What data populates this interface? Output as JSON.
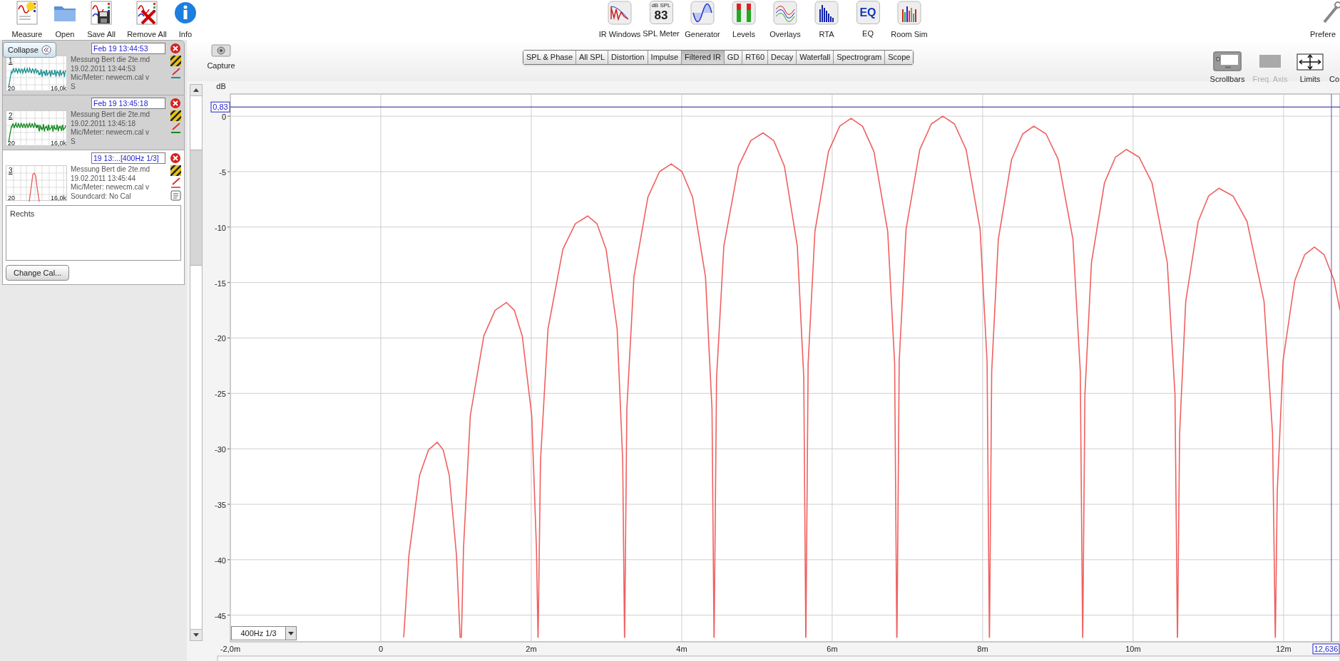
{
  "toolbar": {
    "left": [
      {
        "label": "Measure"
      },
      {
        "label": "Open"
      },
      {
        "label": "Save All"
      },
      {
        "label": "Remove All"
      },
      {
        "label": "Info"
      }
    ],
    "center": [
      {
        "label": "IR Windows"
      },
      {
        "label": "SPL Meter",
        "icon_caption": "dB SPL",
        "icon_value": "83"
      },
      {
        "label": "Generator"
      },
      {
        "label": "Levels"
      },
      {
        "label": "Overlays"
      },
      {
        "label": "RTA"
      },
      {
        "label": "EQ",
        "icon_value": "EQ"
      },
      {
        "label": "Room Sim"
      }
    ],
    "right": [
      {
        "label": "Prefere"
      }
    ]
  },
  "collapse_button": {
    "label": "Collapse"
  },
  "measurements": [
    {
      "title": "Feb 19 13:44:53",
      "number": "1",
      "min_label": "20",
      "max_label": "16,0k",
      "color": "#1a9090",
      "lines": [
        "Messung Bert die 2te.md",
        "19.02.2011 13:44:53",
        "Mic/Meter: newecm.cal v",
        "S"
      ],
      "selected": false
    },
    {
      "title": "Feb 19 13:45:18",
      "number": "2",
      "min_label": "20",
      "max_label": "16,0k",
      "color": "#128a1e",
      "lines": [
        "Messung Bert die 2te.md",
        "19.02.2011 13:45:18",
        "Mic/Meter: newecm.cal v",
        "S"
      ],
      "selected": false
    },
    {
      "title": "19 13:...[400Hz 1/3]",
      "number": "3",
      "min_label": "20",
      "max_label": "16,0k",
      "color": "#e85a5a",
      "lines": [
        "Messung Bert die 2te.md",
        "19.02.2011 13:45:44",
        "Mic/Meter: newecm.cal v",
        "Soundcard: No Cal"
      ],
      "selected": true,
      "notes": "Rechts",
      "button": "Change Cal..."
    }
  ],
  "capture_button": {
    "label": "Capture"
  },
  "graph_tabs": [
    {
      "label": "SPL & Phase",
      "selected": false
    },
    {
      "label": "All SPL",
      "selected": false
    },
    {
      "label": "Distortion",
      "selected": false
    },
    {
      "label": "Impulse",
      "selected": false
    },
    {
      "label": "Filtered IR",
      "selected": true
    },
    {
      "label": "GD",
      "selected": false
    },
    {
      "label": "RT60",
      "selected": false
    },
    {
      "label": "Decay",
      "selected": false
    },
    {
      "label": "Waterfall",
      "selected": false
    },
    {
      "label": "Spectrogram",
      "selected": false
    },
    {
      "label": "Scope",
      "selected": false
    }
  ],
  "graph_tools": [
    {
      "label": "Scrollbars",
      "on": true,
      "disabled": false
    },
    {
      "label": "Freq. Axis",
      "on": false,
      "disabled": true
    },
    {
      "label": "Limits",
      "on": false,
      "disabled": false
    },
    {
      "label": "Co",
      "on": false,
      "disabled": false
    }
  ],
  "graph": {
    "smoothing_dropdown": {
      "value": "400Hz 1/3"
    },
    "chart_data": {
      "type": "line",
      "ylabel": "dB",
      "grid": true,
      "x": [
        0.304,
        0.374,
        0.515,
        0.633,
        0.75,
        0.83,
        0.91,
        1.006,
        1.054,
        1.071,
        1.1,
        1.19,
        1.37,
        1.52,
        1.67,
        1.775,
        1.88,
        2.006,
        2.069,
        2.089,
        2.091,
        2.123,
        2.222,
        2.42,
        2.585,
        2.75,
        2.873,
        2.995,
        3.142,
        3.216,
        3.239,
        3.241,
        3.271,
        3.364,
        3.55,
        3.705,
        3.86,
        4.003,
        4.145,
        4.316,
        4.402,
        4.429,
        4.431,
        4.463,
        4.56,
        4.755,
        4.918,
        5.08,
        5.223,
        5.365,
        5.536,
        5.622,
        5.649,
        5.651,
        5.68,
        5.77,
        5.95,
        6.1,
        6.25,
        6.403,
        6.555,
        6.738,
        6.83,
        6.859,
        6.861,
        6.891,
        6.982,
        7.165,
        7.318,
        7.47,
        7.625,
        7.78,
        7.966,
        8.059,
        8.089,
        8.091,
        8.12,
        8.208,
        8.385,
        8.533,
        8.68,
        8.843,
        9.005,
        9.2,
        9.298,
        9.329,
        9.331,
        9.359,
        9.446,
        9.62,
        9.765,
        9.91,
        10.08,
        10.25,
        10.454,
        10.556,
        10.589,
        10.591,
        10.618,
        10.7,
        10.865,
        11.003,
        11.14,
        11.328,
        11.515,
        11.74,
        11.853,
        11.889,
        11.891,
        11.916,
        11.994,
        12.15,
        12.28,
        12.41,
        12.54,
        12.67,
        12.75
      ],
      "series": [
        {
          "color": "#f06060",
          "values": [
            -47,
            -39.6,
            -32.4,
            -30.1,
            -29.4,
            -30.1,
            -32.4,
            -39.6,
            -47,
            -47,
            -38.9,
            -27.0,
            -19.8,
            -17.5,
            -16.8,
            -17.5,
            -19.8,
            -27.0,
            -38.9,
            -47,
            -47,
            -31.1,
            -19.2,
            -12.0,
            -9.7,
            -9.0,
            -9.7,
            -12.0,
            -19.2,
            -31.1,
            -47,
            -47,
            -26.4,
            -14.5,
            -7.3,
            -5.0,
            -4.3,
            -5.0,
            -7.3,
            -14.5,
            -26.4,
            -47,
            -47,
            -23.6,
            -11.7,
            -4.5,
            -2.2,
            -1.5,
            -2.2,
            -4.5,
            -11.7,
            -23.6,
            -47,
            -47,
            -22.3,
            -10.4,
            -3.2,
            -0.9,
            -0.2,
            -0.9,
            -3.2,
            -10.4,
            -22.3,
            -47,
            -47,
            -22.1,
            -10.2,
            -3.0,
            -0.7,
            0,
            -0.7,
            -3.0,
            -10.2,
            -22.1,
            -47,
            -47,
            -23.0,
            -11.1,
            -3.9,
            -1.6,
            -0.9,
            -1.6,
            -3.9,
            -11.1,
            -23.0,
            -47,
            -47,
            -25.1,
            -13.2,
            -6.0,
            -3.7,
            -3.0,
            -3.7,
            -6.0,
            -13.2,
            -25.1,
            -47,
            -47,
            -28.6,
            -16.7,
            -9.5,
            -7.2,
            -6.5,
            -7.2,
            -9.5,
            -16.7,
            -28.6,
            -47,
            -47,
            -33.9,
            -22.0,
            -14.8,
            -12.5,
            -11.8,
            -12.5,
            -14.8,
            -17.5
          ]
        }
      ],
      "xlim": [
        -2,
        12.75
      ],
      "ylim": [
        -47.4,
        2
      ],
      "xticks": [
        {
          "value": -2,
          "label": "-2,0m"
        },
        {
          "value": 0,
          "label": "0"
        },
        {
          "value": 2,
          "label": "2m"
        },
        {
          "value": 4,
          "label": "4m"
        },
        {
          "value": 6,
          "label": "6m"
        },
        {
          "value": 8,
          "label": "8m"
        },
        {
          "value": 10,
          "label": "10m"
        },
        {
          "value": 12,
          "label": "12m"
        }
      ],
      "yticks": [
        0,
        -5,
        -10,
        -15,
        -20,
        -25,
        -30,
        -35,
        -40,
        -45
      ],
      "ref_lines": [
        {
          "axis": "y",
          "value": 0.83,
          "label": "0,83"
        },
        {
          "axis": "x",
          "value": 12.636,
          "label": "12,636"
        }
      ]
    }
  }
}
